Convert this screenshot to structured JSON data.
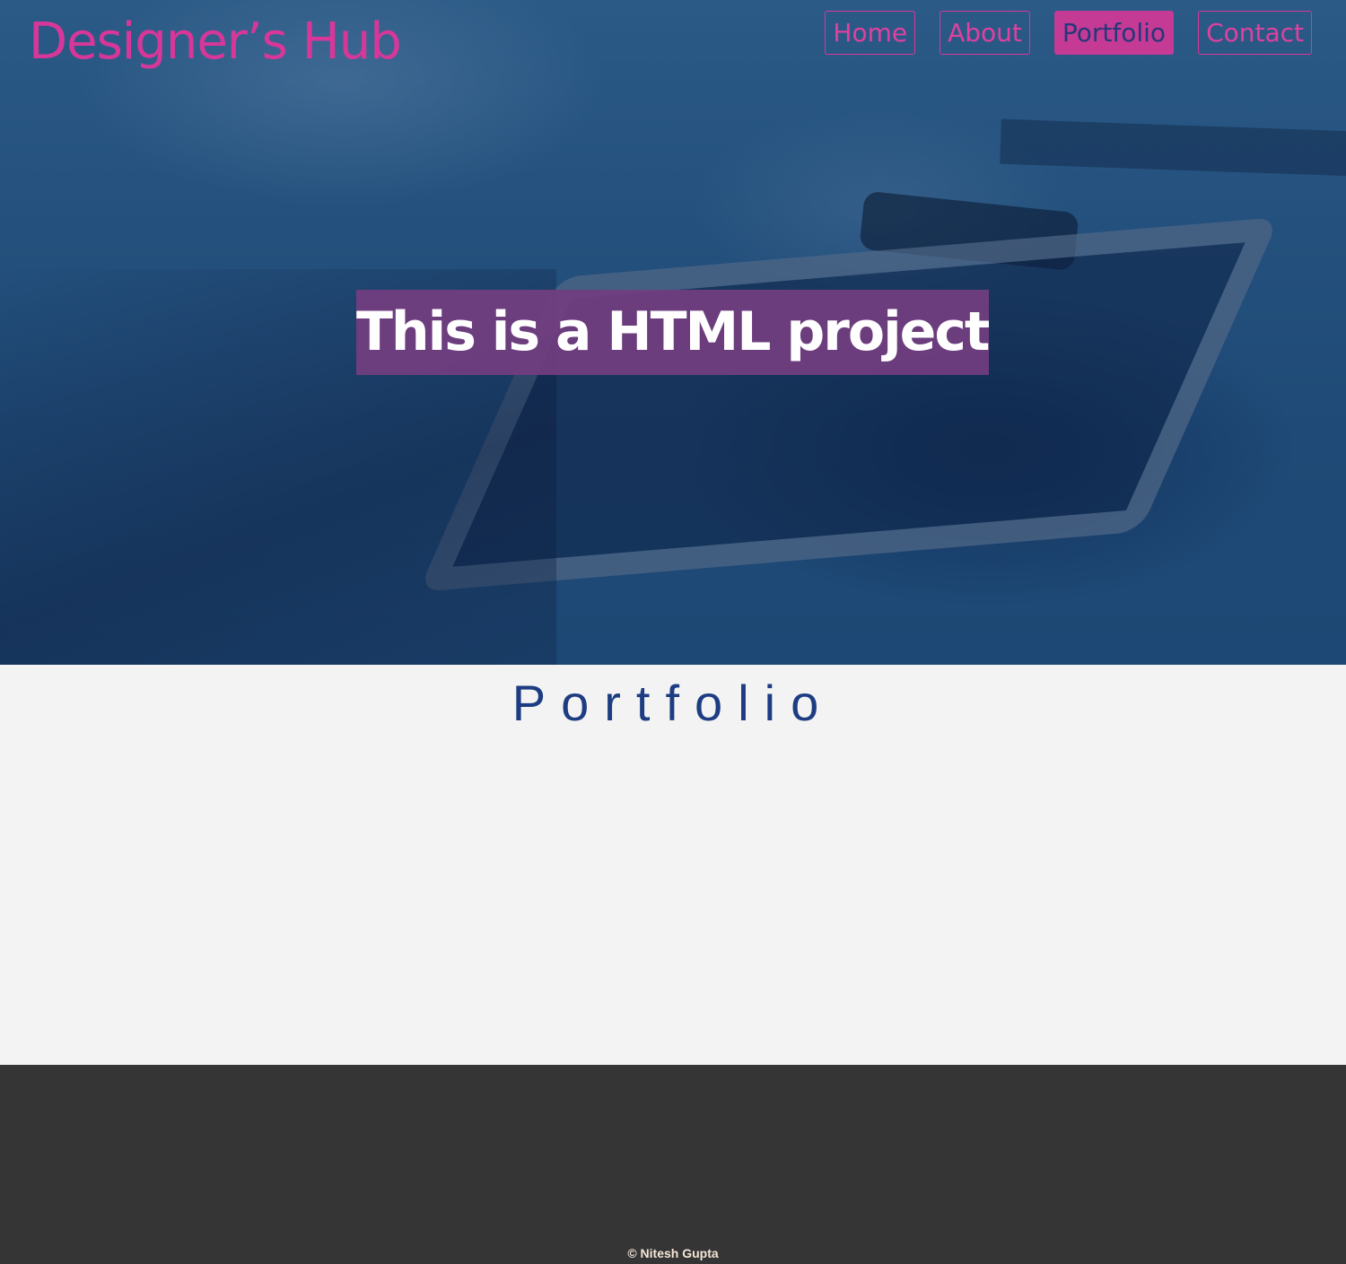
{
  "header": {
    "logo": "Designer’s Hub",
    "nav": [
      {
        "label": "Home",
        "active": false
      },
      {
        "label": "About",
        "active": false
      },
      {
        "label": "Portfolio",
        "active": true
      },
      {
        "label": "Contact",
        "active": false
      }
    ]
  },
  "hero": {
    "title": "This is a HTML project."
  },
  "portfolio": {
    "heading": "Portfolio"
  },
  "footer": {
    "copyright": "© Nitesh Gupta"
  },
  "colors": {
    "accent_pink": "#d8379a",
    "heading_blue": "#1e3c82",
    "hero_overlay": "#24507d",
    "title_background": "#733e80",
    "footer_background": "#353535"
  }
}
